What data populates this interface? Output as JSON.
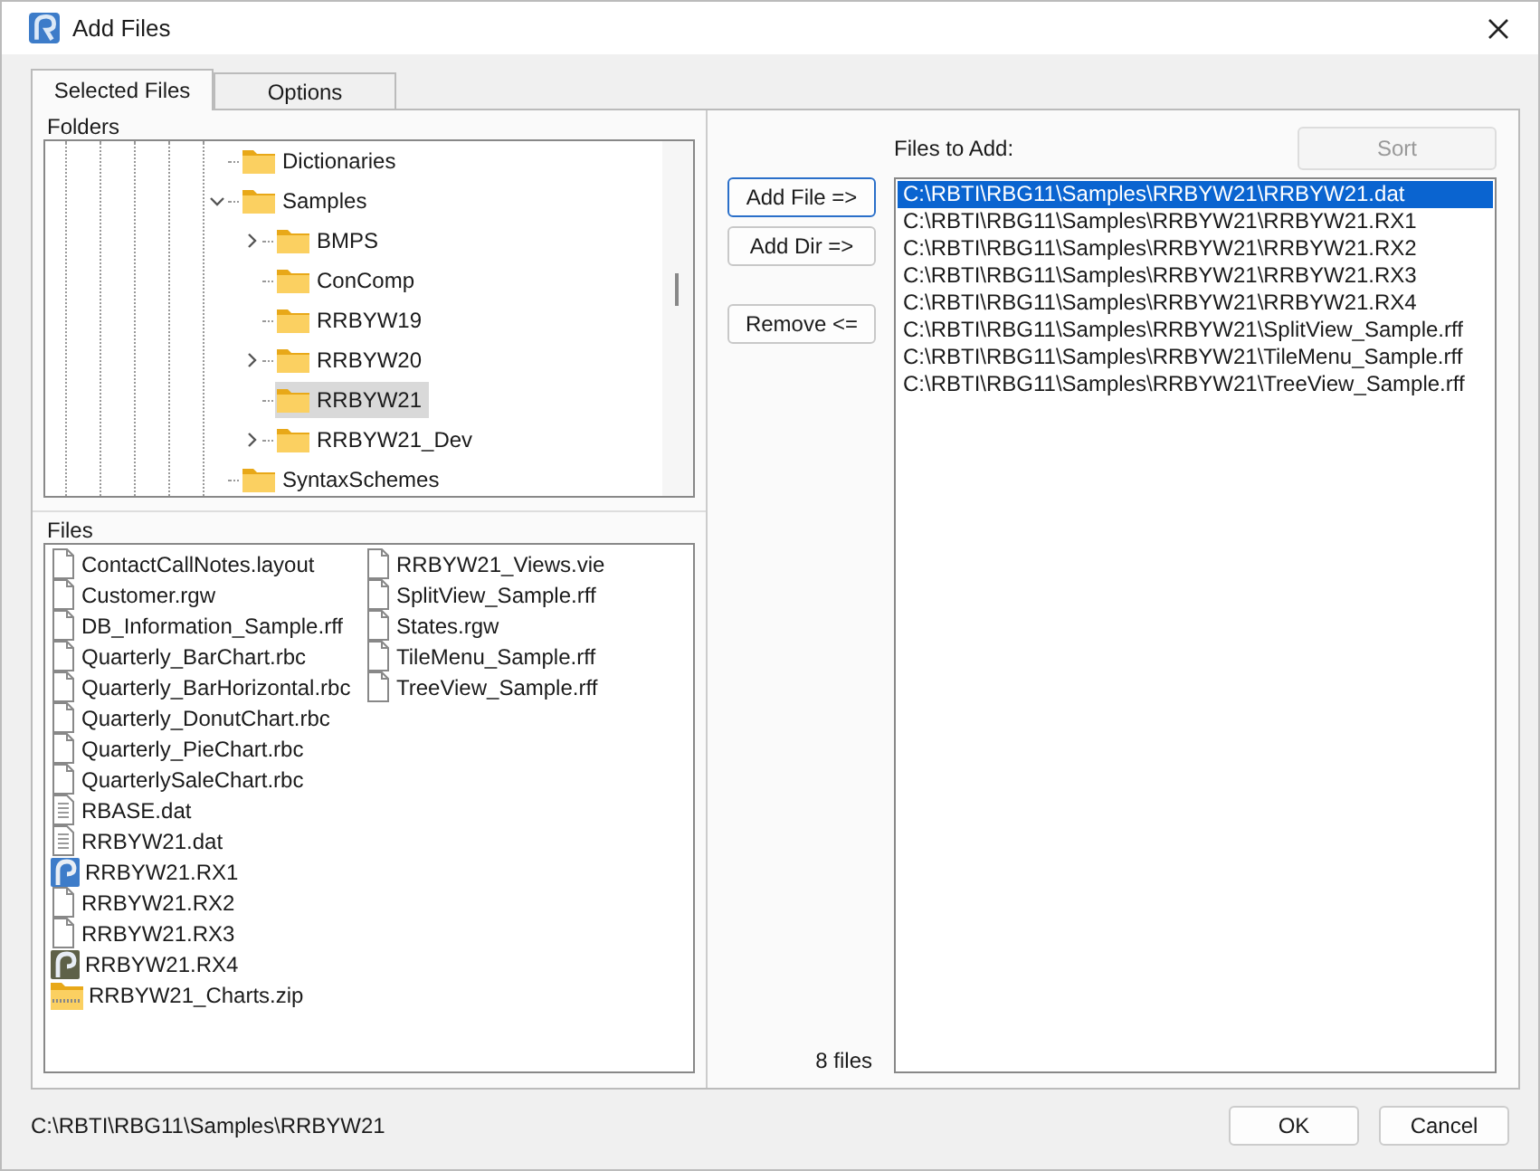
{
  "window": {
    "title": "Add Files"
  },
  "tabs": [
    {
      "label": "Selected Files",
      "selected": true
    },
    {
      "label": "Options",
      "selected": false
    }
  ],
  "folders": {
    "label": "Folders",
    "items": [
      {
        "name": "Dictionaries",
        "expandable": false,
        "selected": false
      },
      {
        "name": "Samples",
        "expandable": true,
        "expanded": true,
        "selected": false,
        "children": [
          {
            "name": "BMPS",
            "expandable": true,
            "expanded": false,
            "selected": false
          },
          {
            "name": "ConComp",
            "expandable": false,
            "selected": false
          },
          {
            "name": "RRBYW19",
            "expandable": false,
            "selected": false
          },
          {
            "name": "RRBYW20",
            "expandable": true,
            "expanded": false,
            "selected": false
          },
          {
            "name": "RRBYW21",
            "expandable": false,
            "selected": true
          },
          {
            "name": "RRBYW21_Dev",
            "expandable": true,
            "expanded": false,
            "selected": false
          }
        ]
      },
      {
        "name": "SyntaxSchemes",
        "expandable": false,
        "selected": false
      }
    ]
  },
  "files": {
    "label": "Files",
    "items": [
      {
        "name": "ContactCallNotes.layout",
        "kind": "file"
      },
      {
        "name": "Customer.rgw",
        "kind": "file"
      },
      {
        "name": "DB_Information_Sample.rff",
        "kind": "file"
      },
      {
        "name": "Quarterly_BarChart.rbc",
        "kind": "file"
      },
      {
        "name": "Quarterly_BarHorizontal.rbc",
        "kind": "file"
      },
      {
        "name": "Quarterly_DonutChart.rbc",
        "kind": "file"
      },
      {
        "name": "Quarterly_PieChart.rbc",
        "kind": "file"
      },
      {
        "name": "QuarterlySaleChart.rbc",
        "kind": "file"
      },
      {
        "name": "RBASE.dat",
        "kind": "text"
      },
      {
        "name": "RRBYW21.dat",
        "kind": "text"
      },
      {
        "name": "RRBYW21.RX1",
        "kind": "app"
      },
      {
        "name": "RRBYW21.RX2",
        "kind": "file"
      },
      {
        "name": "RRBYW21.RX3",
        "kind": "file"
      },
      {
        "name": "RRBYW21.RX4",
        "kind": "app-dark"
      },
      {
        "name": "RRBYW21_Charts.zip",
        "kind": "zip"
      },
      {
        "name": "RRBYW21_Views.vie",
        "kind": "file"
      },
      {
        "name": "SplitView_Sample.rff",
        "kind": "file"
      },
      {
        "name": "States.rgw",
        "kind": "file"
      },
      {
        "name": "TileMenu_Sample.rff",
        "kind": "file"
      },
      {
        "name": "TreeView_Sample.rff",
        "kind": "file"
      }
    ]
  },
  "actions": [
    {
      "label": "Add File =>",
      "focused": true
    },
    {
      "label": "Add Dir  =>",
      "focused": false
    },
    {
      "label": "Remove <=",
      "focused": false
    }
  ],
  "file_count": "8 files",
  "files_to_add": {
    "label": "Files to Add:",
    "sort_button": {
      "label": "Sort",
      "disabled": true
    },
    "items": [
      {
        "path": "C:\\RBTI\\RBG11\\Samples\\RRBYW21\\RRBYW21.dat",
        "selected": true
      },
      {
        "path": "C:\\RBTI\\RBG11\\Samples\\RRBYW21\\RRBYW21.RX1",
        "selected": false
      },
      {
        "path": "C:\\RBTI\\RBG11\\Samples\\RRBYW21\\RRBYW21.RX2",
        "selected": false
      },
      {
        "path": "C:\\RBTI\\RBG11\\Samples\\RRBYW21\\RRBYW21.RX3",
        "selected": false
      },
      {
        "path": "C:\\RBTI\\RBG11\\Samples\\RRBYW21\\RRBYW21.RX4",
        "selected": false
      },
      {
        "path": "C:\\RBTI\\RBG11\\Samples\\RRBYW21\\SplitView_Sample.rff",
        "selected": false
      },
      {
        "path": "C:\\RBTI\\RBG11\\Samples\\RRBYW21\\TileMenu_Sample.rff",
        "selected": false
      },
      {
        "path": "C:\\RBTI\\RBG11\\Samples\\RRBYW21\\TreeView_Sample.rff",
        "selected": false
      }
    ]
  },
  "status_path": "C:\\RBTI\\RBG11\\Samples\\RRBYW21",
  "buttons": [
    {
      "label": "OK"
    },
    {
      "label": "Cancel"
    }
  ]
}
